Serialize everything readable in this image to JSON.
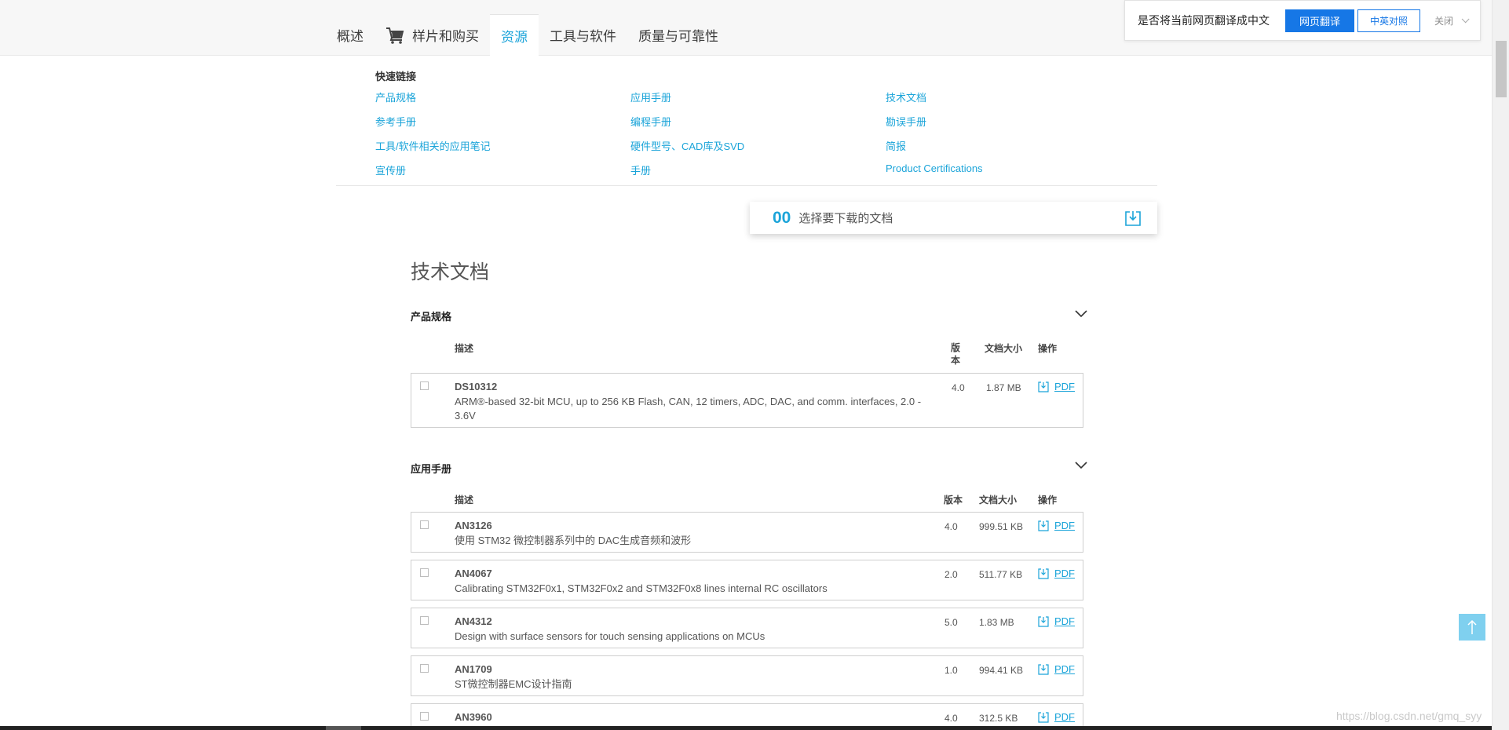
{
  "nav": {
    "tabs": [
      {
        "label": "概述"
      },
      {
        "label": "样片和购买"
      },
      {
        "label": "资源"
      },
      {
        "label": "工具与软件"
      },
      {
        "label": "质量与可靠性"
      }
    ],
    "active_color": "#1aa3d9"
  },
  "translate_bar": {
    "question": "是否将当前网页翻译成中文",
    "translate_button": "网页翻译",
    "bilingual_button": "中英对照",
    "close_label": "关闭"
  },
  "quick_links": {
    "title": "快速链接",
    "items": [
      "产品规格",
      "应用手册",
      "技术文档",
      "参考手册",
      "编程手册",
      "勘误手册",
      "工具/软件相关的应用笔记",
      "硬件型号、CAD库及SVD",
      "简报",
      "宣传册",
      "手册",
      "Product Certifications"
    ]
  },
  "download_card": {
    "count": "00",
    "label": "选择要下载的文档"
  },
  "section_title": "技术文档",
  "groups": [
    {
      "title": "产品规格",
      "headers": {
        "desc": "描述",
        "version": "版\n本",
        "size": "文档大小",
        "action": "操作"
      },
      "rows": [
        {
          "code": "DS10312",
          "desc": "ARM®-based 32-bit MCU, up to 256 KB Flash, CAN, 12 timers, ADC, DAC, and comm. interfaces, 2.0 -\n3.6V",
          "version": "4.0",
          "size": "1.87 MB",
          "action": "PDF"
        }
      ]
    },
    {
      "title": "应用手册",
      "headers": {
        "desc": "描述",
        "version": "版本",
        "size": "文档大小",
        "action": "操作"
      },
      "rows": [
        {
          "code": "AN3126",
          "desc": "使用 STM32 微控制器系列中的 DAC生成音频和波形",
          "version": "4.0",
          "size": "999.51 KB",
          "action": "PDF"
        },
        {
          "code": "AN4067",
          "desc": "Calibrating STM32F0x1, STM32F0x2 and STM32F0x8 lines internal RC oscillators",
          "version": "2.0",
          "size": "511.77 KB",
          "action": "PDF"
        },
        {
          "code": "AN4312",
          "desc": "Design with surface sensors for touch sensing applications on MCUs",
          "version": "5.0",
          "size": "1.83 MB",
          "action": "PDF"
        },
        {
          "code": "AN1709",
          "desc": "ST微控制器EMC设计指南",
          "version": "1.0",
          "size": "994.41 KB",
          "action": "PDF"
        },
        {
          "code": "AN3960",
          "desc": "",
          "version": "4.0",
          "size": "312.5 KB",
          "action": "PDF"
        }
      ]
    }
  ],
  "watermark": "https://blog.csdn.net/gmq_syy"
}
